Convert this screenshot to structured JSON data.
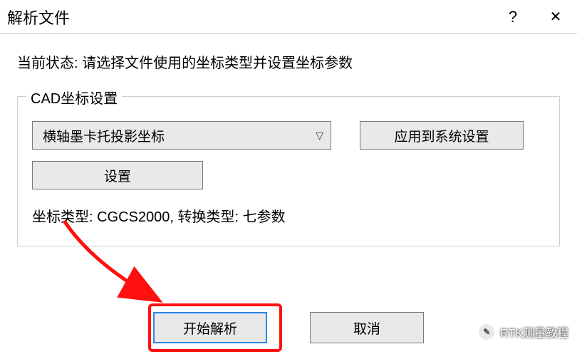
{
  "titlebar": {
    "title": "解析文件",
    "help": "?",
    "close": "✕"
  },
  "status": {
    "label": "当前状态:",
    "text": "请选择文件使用的坐标类型并设置坐标参数"
  },
  "group": {
    "title": "CAD坐标设置",
    "combo_value": "横轴墨卡托投影坐标",
    "apply_label": "应用到系统设置",
    "setup_label": "设置",
    "details": "坐标类型: CGCS2000, 转换类型: 七参数"
  },
  "buttons": {
    "start": "开始解析",
    "cancel": "取消"
  },
  "watermark": {
    "icon": "✎",
    "text": "RTK测量教程"
  }
}
